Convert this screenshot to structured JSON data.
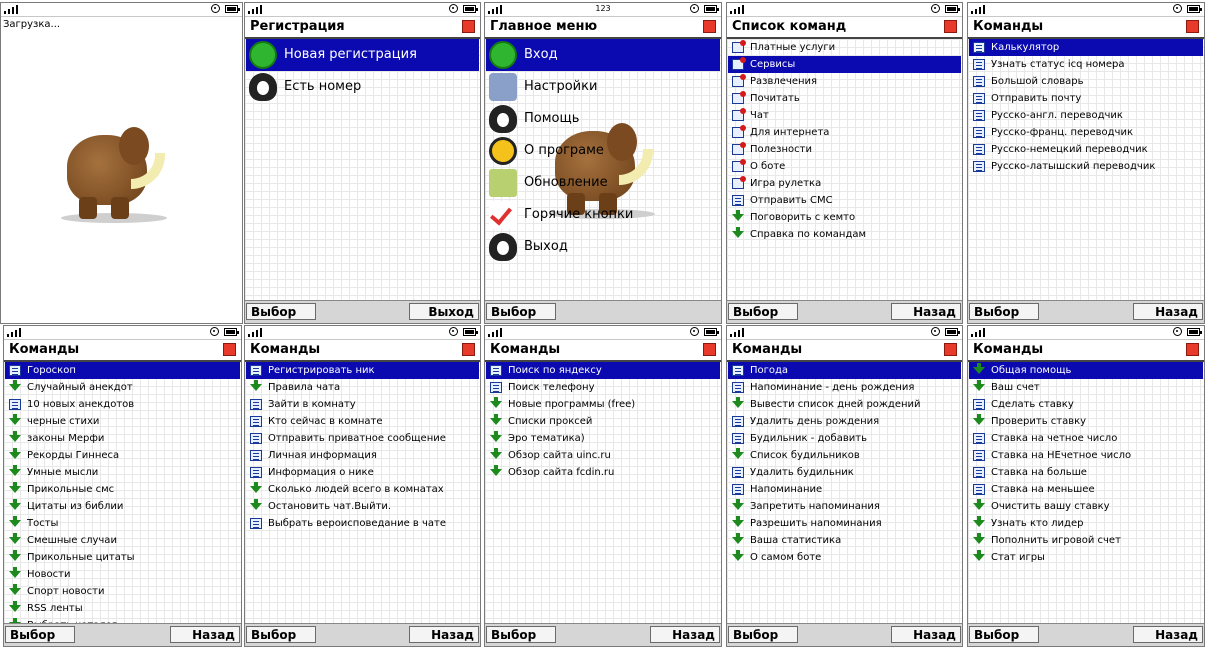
{
  "status_center": "123",
  "loading_text": "Загрузка...",
  "softkeys": {
    "select": "Выбор",
    "exit": "Выход",
    "back": "Назад"
  },
  "screens": {
    "registration": {
      "title": "Регистрация",
      "items": [
        {
          "label": "Новая регистрация",
          "icon": "runner-icon",
          "selected": true
        },
        {
          "label": "Есть номер",
          "icon": "penguin-icon",
          "selected": false
        }
      ]
    },
    "main_menu": {
      "title": "Главное меню",
      "items": [
        {
          "label": "Вход",
          "icon": "runner-icon",
          "selected": true
        },
        {
          "label": "Настройки",
          "icon": "tools-icon",
          "selected": false
        },
        {
          "label": "Помощь",
          "icon": "penguin-icon",
          "selected": false
        },
        {
          "label": "О програме",
          "icon": "help-icon",
          "selected": false
        },
        {
          "label": "Обновление",
          "icon": "box-icon",
          "selected": false
        },
        {
          "label": "Горячие кнопки",
          "icon": "abc-check-icon",
          "selected": false
        },
        {
          "label": "Выход",
          "icon": "penguin-icon",
          "selected": false
        }
      ]
    },
    "command_list": {
      "title": "Список команд",
      "items": [
        {
          "label": "Платные услуги",
          "icon": "folder-page-icon"
        },
        {
          "label": "Сервисы",
          "icon": "folder-page-icon",
          "selected": true
        },
        {
          "label": "Развлечения",
          "icon": "folder-page-icon"
        },
        {
          "label": "Почитать",
          "icon": "folder-page-icon"
        },
        {
          "label": "Чат",
          "icon": "folder-page-icon"
        },
        {
          "label": "Для интернета",
          "icon": "folder-page-icon"
        },
        {
          "label": "Полезности",
          "icon": "folder-page-icon"
        },
        {
          "label": "О боте",
          "icon": "folder-page-icon"
        },
        {
          "label": "Игра рулетка",
          "icon": "folder-page-icon"
        },
        {
          "label": "Отправить СМС",
          "icon": "page-icon"
        },
        {
          "label": "Поговорить с кемто",
          "icon": "arrow-down-icon"
        },
        {
          "label": "Справка по командам",
          "icon": "arrow-down-icon"
        }
      ]
    },
    "cmd_services": {
      "title": "Команды",
      "items": [
        {
          "label": "Калькулятор",
          "icon": "page-icon",
          "selected": true
        },
        {
          "label": "Узнать статус icq номера",
          "icon": "page-icon"
        },
        {
          "label": "Большой словарь",
          "icon": "page-icon"
        },
        {
          "label": "Отправить почту",
          "icon": "page-icon"
        },
        {
          "label": "Русско-англ. переводчик",
          "icon": "page-icon"
        },
        {
          "label": "Русско-франц. переводчик",
          "icon": "page-icon"
        },
        {
          "label": "Русско-немецкий переводчик",
          "icon": "page-icon"
        },
        {
          "label": "Русско-латышский переводчик",
          "icon": "page-icon"
        }
      ]
    },
    "cmd_fun": {
      "title": "Команды",
      "items": [
        {
          "label": "Гороскоп",
          "icon": "page-icon",
          "selected": true
        },
        {
          "label": "Случайный анекдот",
          "icon": "arrow-down-icon"
        },
        {
          "label": "10 новых анекдотов",
          "icon": "page-icon"
        },
        {
          "label": "черные стихи",
          "icon": "arrow-down-icon"
        },
        {
          "label": "законы Мерфи",
          "icon": "arrow-down-icon"
        },
        {
          "label": "Рекорды Гиннеса",
          "icon": "arrow-down-icon"
        },
        {
          "label": "Умные мысли",
          "icon": "arrow-down-icon"
        },
        {
          "label": "Прикольные смс",
          "icon": "arrow-down-icon"
        },
        {
          "label": "Цитаты из библии",
          "icon": "arrow-down-icon"
        },
        {
          "label": "Тосты",
          "icon": "arrow-down-icon"
        },
        {
          "label": "Смешные случаи",
          "icon": "arrow-down-icon"
        },
        {
          "label": "Прикольные цитаты",
          "icon": "arrow-down-icon"
        },
        {
          "label": "Новости",
          "icon": "arrow-down-icon"
        },
        {
          "label": "Спорт новости",
          "icon": "arrow-down-icon"
        },
        {
          "label": "RSS ленты",
          "icon": "arrow-down-icon"
        },
        {
          "label": "Выбрать каталог",
          "icon": "arrow-down-icon"
        }
      ]
    },
    "cmd_chat": {
      "title": "Команды",
      "items": [
        {
          "label": "Регистрировать ник",
          "icon": "page-icon",
          "selected": true
        },
        {
          "label": "Правила чата",
          "icon": "arrow-down-icon"
        },
        {
          "label": "Зайти в комнату",
          "icon": "page-icon"
        },
        {
          "label": "Кто сейчас в комнате",
          "icon": "page-icon"
        },
        {
          "label": "Отправить приватное сообщение",
          "icon": "page-icon"
        },
        {
          "label": "Личная информация",
          "icon": "page-icon"
        },
        {
          "label": "Информация о нике",
          "icon": "page-icon"
        },
        {
          "label": "Сколько людей всего в комнатах",
          "icon": "arrow-down-icon"
        },
        {
          "label": "Остановить чат.Выйти.",
          "icon": "arrow-down-icon"
        },
        {
          "label": "Выбрать вероисповедание в чате",
          "icon": "page-icon"
        }
      ]
    },
    "cmd_internet": {
      "title": "Команды",
      "items": [
        {
          "label": "Поиск по яндексу",
          "icon": "page-icon",
          "selected": true
        },
        {
          "label": "Поиск телефону",
          "icon": "page-icon"
        },
        {
          "label": "Новые программы (free)",
          "icon": "arrow-down-icon"
        },
        {
          "label": "Списки проксей",
          "icon": "arrow-down-icon"
        },
        {
          "label": "Эро тематика)",
          "icon": "arrow-down-icon"
        },
        {
          "label": "Обзор сайта uinc.ru",
          "icon": "arrow-down-icon"
        },
        {
          "label": "Обзор сайта fcdin.ru",
          "icon": "arrow-down-icon"
        }
      ]
    },
    "cmd_useful": {
      "title": "Команды",
      "items": [
        {
          "label": "Погода",
          "icon": "page-icon",
          "selected": true
        },
        {
          "label": "Напоминание - день рождения",
          "icon": "page-icon"
        },
        {
          "label": "Вывести список дней рождений",
          "icon": "arrow-down-icon"
        },
        {
          "label": "Удалить день рождения",
          "icon": "page-icon"
        },
        {
          "label": "Будильник - добавить",
          "icon": "page-icon"
        },
        {
          "label": "Список будильников",
          "icon": "arrow-down-icon"
        },
        {
          "label": "Удалить будильник",
          "icon": "page-icon"
        },
        {
          "label": "Напоминание",
          "icon": "page-icon"
        },
        {
          "label": "Запретить напоминания",
          "icon": "arrow-down-icon"
        },
        {
          "label": "Разрешить напоминания",
          "icon": "arrow-down-icon"
        },
        {
          "label": "Ваша статистика",
          "icon": "arrow-down-icon"
        },
        {
          "label": "О самом боте",
          "icon": "arrow-down-icon"
        }
      ]
    },
    "cmd_roulette": {
      "title": "Команды",
      "items": [
        {
          "label": "Общая помощь",
          "icon": "arrow-down-icon",
          "selected": true
        },
        {
          "label": "Ваш счет",
          "icon": "arrow-down-icon"
        },
        {
          "label": "Сделать ставку",
          "icon": "page-icon"
        },
        {
          "label": "Проверить ставку",
          "icon": "arrow-down-icon"
        },
        {
          "label": "Ставка на четное число",
          "icon": "page-icon"
        },
        {
          "label": "Ставка на НЕчетное число",
          "icon": "page-icon"
        },
        {
          "label": "Ставка на больше",
          "icon": "page-icon"
        },
        {
          "label": "Ставка на меньшее",
          "icon": "page-icon"
        },
        {
          "label": "Очистить вашу ставку",
          "icon": "arrow-down-icon"
        },
        {
          "label": "Узнать кто лидер",
          "icon": "arrow-down-icon"
        },
        {
          "label": "Пополнить игровой счет",
          "icon": "arrow-down-icon"
        },
        {
          "label": "Стат игры",
          "icon": "arrow-down-icon"
        }
      ]
    }
  }
}
